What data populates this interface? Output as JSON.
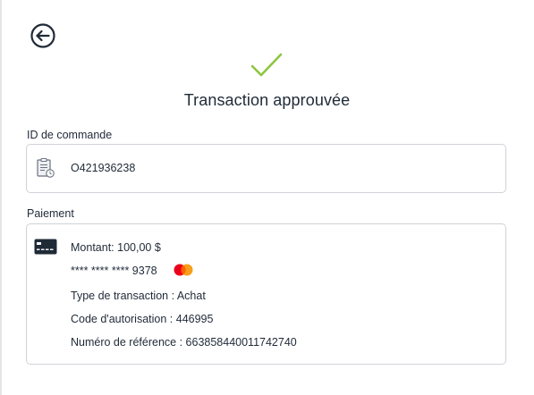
{
  "header": {
    "title": "Transaction approuvée"
  },
  "icons": {
    "back": "arrow-left-circle-icon",
    "success": "checkmark-icon",
    "order": "document-clock-icon",
    "payment": "credit-card-icon",
    "brand": "mastercard-logo"
  },
  "colors": {
    "success": "#8cc63f",
    "text": "#1f2a37",
    "border": "#cfd3d8",
    "card_icon": "#1f2a37",
    "mastercard_red": "#eb001b",
    "mastercard_yellow": "#f79e1b"
  },
  "order": {
    "label": "ID de commande",
    "id": "O421936238"
  },
  "payment": {
    "label": "Paiement",
    "amount": "Montant: 100,00 $",
    "card_number": "**** **** **** 9378",
    "transaction_type": "Type de transaction : Achat",
    "authorization_code": "Code d'autorisation : 446995",
    "reference_number": "Numéro de référence : 663858440011742740"
  }
}
